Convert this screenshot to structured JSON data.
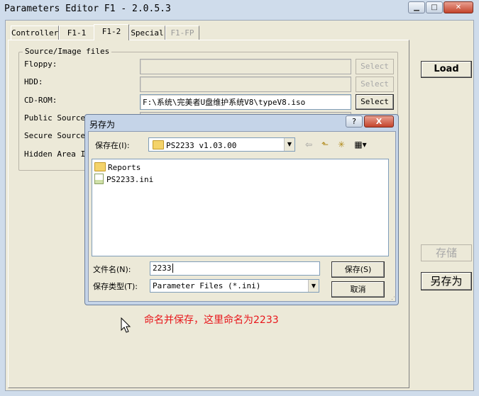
{
  "window": {
    "title": "Parameters Editor F1 - 2.0.5.3",
    "caption_buttons": [
      "minimize-icon",
      "maximize-icon",
      "close-icon"
    ]
  },
  "tabs": [
    {
      "label": "Controller"
    },
    {
      "label": "F1-1"
    },
    {
      "label": "F1-2"
    },
    {
      "label": "Special"
    },
    {
      "label": "F1-FP"
    }
  ],
  "group": {
    "title": "Source/Image files",
    "rows": [
      {
        "label": "Floppy:",
        "value": "",
        "button": "Select"
      },
      {
        "label": "HDD:",
        "value": "",
        "button": "Select"
      },
      {
        "label": "CD-ROM:",
        "value": "F:\\系统\\完美者U盘维护系统V8\\typeV8.iso",
        "button": "Select"
      },
      {
        "label": "Public Source",
        "value": ""
      },
      {
        "label": "Secure Source",
        "value": ""
      },
      {
        "label": "Hidden Area Im",
        "value": ""
      }
    ]
  },
  "right_buttons": {
    "load": "Load",
    "save": "存储",
    "save_as": "另存为"
  },
  "dialog": {
    "title": "另存为",
    "help": "?",
    "close": "X",
    "save_in_label": "保存在(I):",
    "save_in_value": "PS2233 v1.03.00",
    "files": [
      {
        "name": "Reports",
        "icon": "folder-icon"
      },
      {
        "name": "PS2233.ini",
        "icon": "ini-file-icon"
      }
    ],
    "filename_label": "文件名(N):",
    "filename_value": "2233",
    "filetype_label": "保存类型(T):",
    "filetype_value": "Parameter Files (*.ini)",
    "save_button": "保存(S)",
    "cancel_button": "取消"
  },
  "annotation": "命名并保存，这里命名为2233"
}
